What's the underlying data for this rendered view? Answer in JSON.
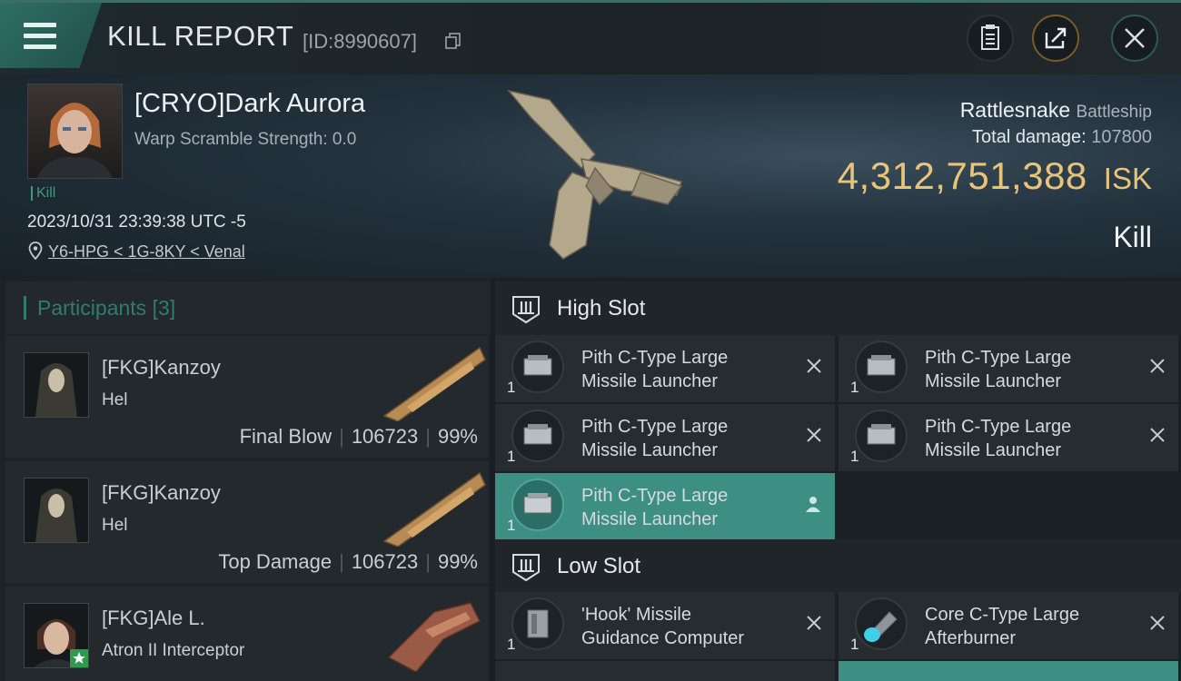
{
  "header": {
    "title": "KILL REPORT",
    "report_id": "[ID:8990607]"
  },
  "victim": {
    "name": "[CRYO]Dark Aurora",
    "warp_scramble": "Warp Scramble Strength: 0.0",
    "kill_tag": "Kill",
    "datetime": "2023/10/31 23:39:38 UTC -5",
    "location": "Y6-HPG < 1G-8KY < Venal",
    "ship_name": "Rattlesnake",
    "ship_class": "Battleship",
    "total_damage_label": "Total damage:",
    "total_damage": "107800",
    "isk_value": "4,312,751,388",
    "isk_unit": "ISK",
    "result": "Kill"
  },
  "participants": {
    "title": "Participants",
    "count": "[3]",
    "rows": [
      {
        "name": "[FKG]Kanzoy",
        "ship": "Hel",
        "label": "Final Blow",
        "damage": "106723",
        "percent": "99%"
      },
      {
        "name": "[FKG]Kanzoy",
        "ship": "Hel",
        "label": "Top Damage",
        "damage": "106723",
        "percent": "99%"
      },
      {
        "name": "[FKG]Ale L.",
        "ship": "Atron II Interceptor"
      }
    ]
  },
  "slots": {
    "high": {
      "title": "High Slot",
      "modules": [
        {
          "name": "Pith C-Type Large Missile Launcher",
          "qty": "1",
          "status": "destroyed"
        },
        {
          "name": "Pith C-Type Large Missile Launcher",
          "qty": "1",
          "status": "destroyed"
        },
        {
          "name": "Pith C-Type Large Missile Launcher",
          "qty": "1",
          "status": "destroyed"
        },
        {
          "name": "Pith C-Type Large Missile Launcher",
          "qty": "1",
          "status": "destroyed"
        },
        {
          "name": "Pith C-Type Large Missile Launcher",
          "qty": "1",
          "status": "dropped"
        }
      ]
    },
    "low": {
      "title": "Low Slot",
      "modules": [
        {
          "name": "'Hook' Missile Guidance Computer",
          "qty": "1",
          "status": "destroyed"
        },
        {
          "name": "Core C-Type Large Afterburner",
          "qty": "1",
          "status": "destroyed"
        }
      ]
    }
  },
  "colors": {
    "accent": "#3d8f84",
    "isk": "#e8c37a",
    "kill_green": "#3f9a7c"
  }
}
